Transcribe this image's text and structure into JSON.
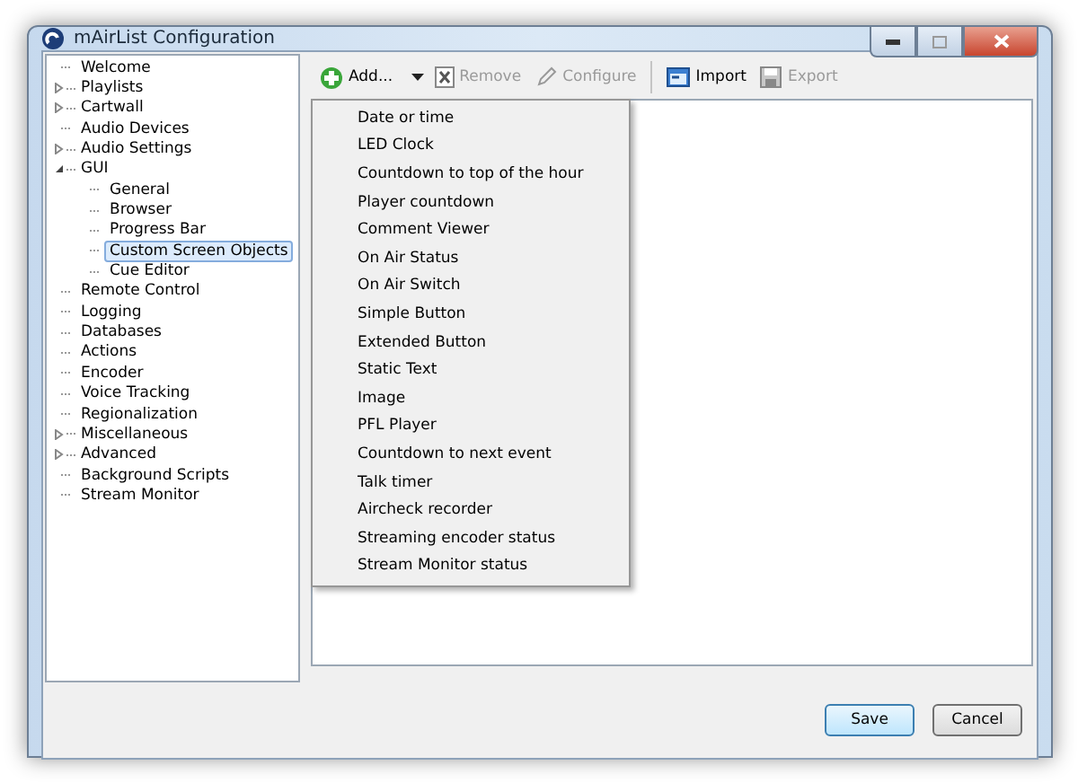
{
  "window": {
    "title": "mAirList Configuration"
  },
  "tree": [
    {
      "label": "Welcome",
      "selected": false
    },
    {
      "label": "Playlists",
      "selected": false,
      "expanded": false
    },
    {
      "label": "Cartwall",
      "selected": false,
      "expanded": false
    },
    {
      "label": "Audio Devices",
      "selected": false
    },
    {
      "label": "Audio Settings",
      "selected": false,
      "expanded": false
    },
    {
      "label": "GUI",
      "selected": false,
      "expanded": true,
      "children": [
        {
          "label": "General",
          "selected": false
        },
        {
          "label": "Browser",
          "selected": false
        },
        {
          "label": "Progress Bar",
          "selected": false
        },
        {
          "label": "Custom Screen Objects",
          "selected": true
        },
        {
          "label": "Cue Editor",
          "selected": false
        }
      ]
    },
    {
      "label": "Remote Control",
      "selected": false
    },
    {
      "label": "Logging",
      "selected": false
    },
    {
      "label": "Databases",
      "selected": false
    },
    {
      "label": "Actions",
      "selected": false
    },
    {
      "label": "Encoder",
      "selected": false
    },
    {
      "label": "Voice Tracking",
      "selected": false
    },
    {
      "label": "Regionalization",
      "selected": false
    },
    {
      "label": "Miscellaneous",
      "selected": false,
      "expanded": false
    },
    {
      "label": "Advanced",
      "selected": false,
      "expanded": false
    },
    {
      "label": "Background Scripts",
      "selected": false
    },
    {
      "label": "Stream Monitor",
      "selected": false
    }
  ],
  "toolbar": [
    {
      "kind": "add",
      "label": "Add...",
      "disabled": false
    },
    {
      "kind": "remove",
      "label": "Remove",
      "disabled": true
    },
    {
      "kind": "configure",
      "label": "Configure",
      "disabled": true
    },
    {
      "kind": "import",
      "label": "Import",
      "disabled": false
    },
    {
      "kind": "export",
      "label": "Export",
      "disabled": true
    }
  ],
  "add_menu": [
    "Date or time",
    "LED Clock",
    "Countdown to top of the hour",
    "Player countdown",
    "Comment Viewer",
    "On Air Status",
    "On Air Switch",
    "Simple Button",
    "Extended Button",
    "Static Text",
    "Image",
    "PFL Player",
    "Countdown to next event",
    "Talk timer",
    "Aircheck recorder",
    "Streaming encoder status",
    "Stream Monitor status"
  ],
  "buttons": [
    {
      "label": "Save",
      "default": true
    },
    {
      "label": "Cancel",
      "default": false
    }
  ]
}
